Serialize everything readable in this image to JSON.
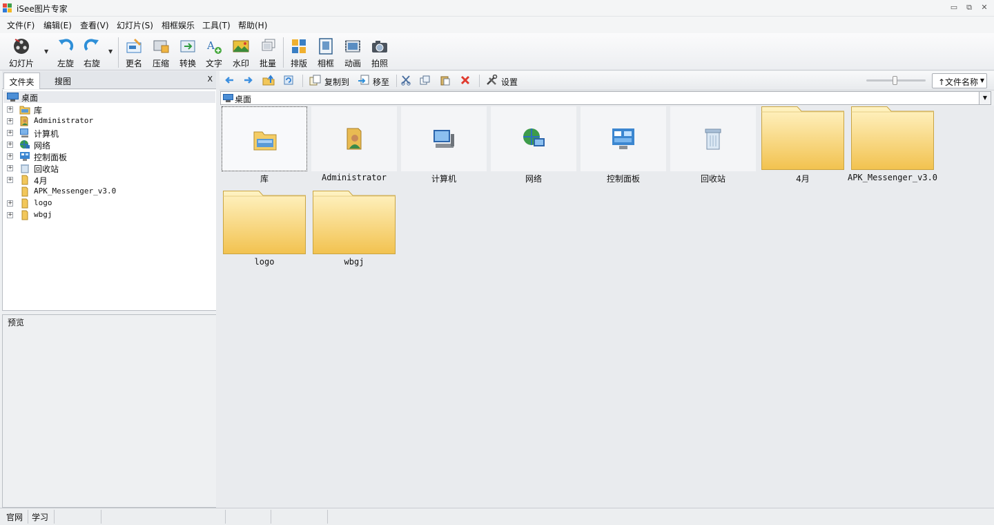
{
  "window": {
    "title": "iSee图片专家",
    "controls": [
      "minimize",
      "restore",
      "close"
    ]
  },
  "menu": [
    "文件(F)",
    "编辑(E)",
    "查看(V)",
    "幻灯片(S)",
    "相框娱乐",
    "工具(T)",
    "帮助(H)"
  ],
  "toolbar": {
    "slideshow": "幻灯片",
    "rotate_left": "左旋",
    "rotate_right": "右旋",
    "rename": "更名",
    "compress": "压缩",
    "convert": "转换",
    "text": "文字",
    "watermark": "水印",
    "batch": "批量",
    "layout": "排版",
    "frame": "相框",
    "animation": "动画",
    "photo": "拍照"
  },
  "left_panel": {
    "tabs": [
      "文件夹",
      "搜图"
    ],
    "close": "X",
    "root": "桌面",
    "tree": [
      {
        "label": "库",
        "expandable": true,
        "icon": "library-icon"
      },
      {
        "label": "Administrator",
        "expandable": true,
        "icon": "user-folder-icon"
      },
      {
        "label": "计算机",
        "expandable": true,
        "icon": "computer-icon"
      },
      {
        "label": "网络",
        "expandable": true,
        "icon": "network-icon"
      },
      {
        "label": "控制面板",
        "expandable": true,
        "icon": "control-panel-icon"
      },
      {
        "label": "回收站",
        "expandable": true,
        "icon": "recycle-bin-icon"
      },
      {
        "label": "4月",
        "expandable": true,
        "icon": "folder-icon"
      },
      {
        "label": "APK_Messenger_v3.0",
        "expandable": false,
        "icon": "folder-icon"
      },
      {
        "label": "logo",
        "expandable": true,
        "icon": "folder-icon"
      },
      {
        "label": "wbgj",
        "expandable": true,
        "icon": "folder-icon"
      }
    ],
    "preview_label": "预览"
  },
  "right_toolbar": {
    "copy_to": "复制到",
    "move_to": "移至",
    "settings": "设置",
    "sort": "↑文件名称"
  },
  "address": {
    "path": "桌面"
  },
  "items": [
    {
      "label": "库",
      "type": "library"
    },
    {
      "label": "Administrator",
      "type": "user"
    },
    {
      "label": "计算机",
      "type": "computer"
    },
    {
      "label": "网络",
      "type": "network"
    },
    {
      "label": "控制面板",
      "type": "control-panel"
    },
    {
      "label": "回收站",
      "type": "recycle-bin"
    },
    {
      "label": "4月",
      "type": "folder"
    },
    {
      "label": "APK_Messenger_v3.0",
      "type": "folder"
    },
    {
      "label": "logo",
      "type": "folder"
    },
    {
      "label": "wbgj",
      "type": "folder"
    }
  ],
  "status": [
    "官网",
    "学习"
  ]
}
